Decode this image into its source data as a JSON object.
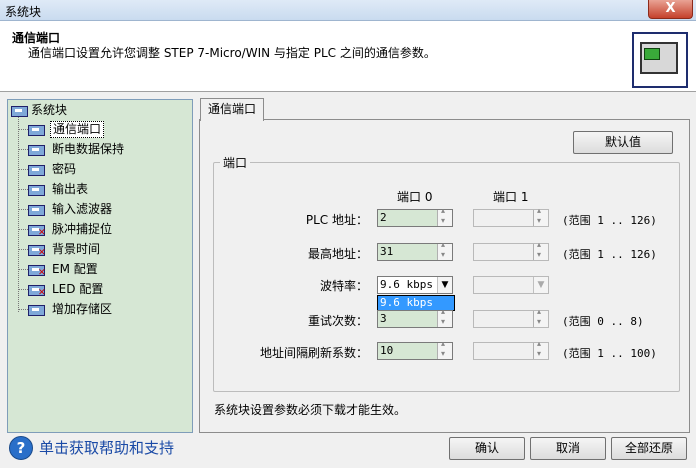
{
  "window": {
    "title": "系统块",
    "close_glyph": "X"
  },
  "header": {
    "title": "通信端口",
    "description": "通信端口设置允许您调整 STEP 7-Micro/WIN 与指定 PLC 之间的通信参数。"
  },
  "tree": {
    "root": "系统块",
    "items": [
      {
        "label": "通信端口",
        "selected": true,
        "error": false
      },
      {
        "label": "断电数据保持",
        "error": false
      },
      {
        "label": "密码",
        "error": false
      },
      {
        "label": "输出表",
        "error": false
      },
      {
        "label": "输入滤波器",
        "error": false
      },
      {
        "label": "脉冲捕捉位",
        "error": true
      },
      {
        "label": "背景时间",
        "error": true
      },
      {
        "label": "EM 配置",
        "error": true
      },
      {
        "label": "LED 配置",
        "error": true
      },
      {
        "label": "增加存储区",
        "error": false
      }
    ]
  },
  "tab": {
    "label": "通信端口"
  },
  "default_button": "默认值",
  "group": {
    "label": "端口",
    "col_port0": "端口 0",
    "col_port1": "端口 1",
    "rows": {
      "plc_address": {
        "label": "PLC 地址：",
        "port0": "2",
        "range": "(范围 1 .. 126)"
      },
      "max_address": {
        "label": "最高地址：",
        "port0": "31",
        "range": "(范围 1 .. 126)"
      },
      "baud_rate": {
        "label": "波特率：",
        "port0": "9.6 kbps",
        "dropdown_option": "9.6 kbps"
      },
      "retry_count": {
        "label": "重试次数：",
        "port0": "3",
        "range": "(范围 0 .. 8)"
      },
      "gap_factor": {
        "label": "地址间隔刷新系数：",
        "port0": "10",
        "range": "(范围 1 .. 100)"
      }
    }
  },
  "note": "系统块设置参数必须下载才能生效。",
  "help": {
    "icon_glyph": "?",
    "link": "单击获取帮助和支持"
  },
  "buttons": {
    "ok": "确认",
    "cancel": "取消",
    "restore_all": "全部还原"
  },
  "colors": {
    "tree_bg": "#d6e7d4",
    "selection": "#3399ff",
    "help_link": "#1a4aa6"
  }
}
